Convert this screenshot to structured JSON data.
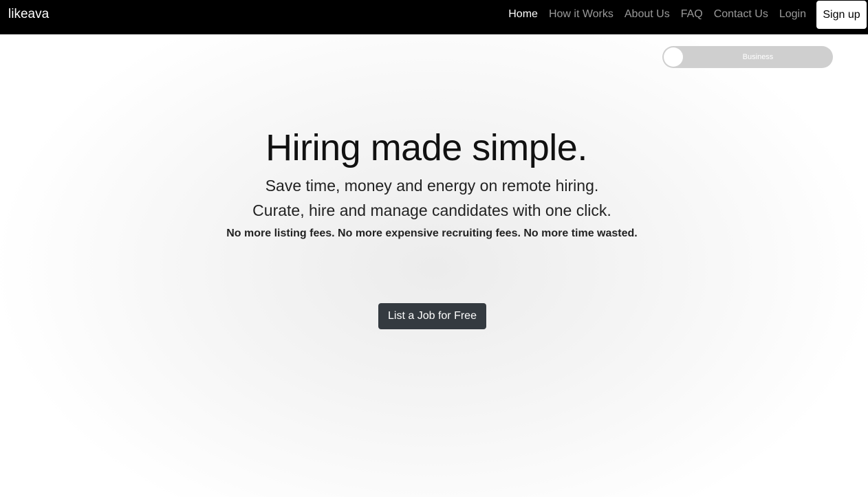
{
  "nav": {
    "brand": "likeava",
    "links": [
      "Home",
      "How it Works",
      "About Us",
      "FAQ",
      "Contact Us",
      "Login"
    ],
    "active": "Home",
    "signup_label": "Sign up"
  },
  "toggle": {
    "label": "Business",
    "state": "off"
  },
  "hero": {
    "title": "Hiring made simple.",
    "line1": "Save time, money and energy on remote hiring.",
    "line2": "Curate, hire and manage candidates with one click.",
    "small": "No more listing fees. No more expensive recruiting fees. No more time wasted.",
    "cta_label": "List a Job for Free"
  },
  "colors": {
    "navbar_bg": "#000000",
    "nav_active": "#ffffff",
    "nav_inactive": "#9a9a9a",
    "cta_bg": "#343a40",
    "toggle_bg": "#cfcfcf"
  }
}
